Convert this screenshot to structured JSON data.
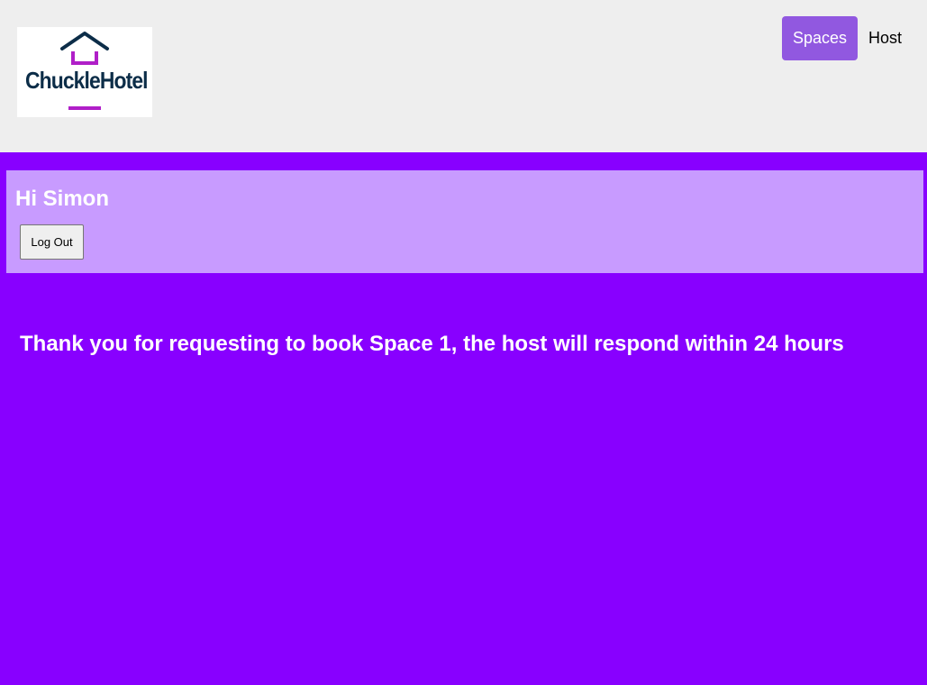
{
  "logo": {
    "brand_text": "ChuckleHotel",
    "alt": "ChuckleHotel logo",
    "colors": {
      "navy": "#0c2d48",
      "magenta": "#b01fc8"
    }
  },
  "nav": {
    "items": [
      {
        "label": "Spaces",
        "active": true
      },
      {
        "label": "Host",
        "active": false
      }
    ]
  },
  "user": {
    "greeting": "Hi Simon",
    "logout_label": "Log Out"
  },
  "confirmation": {
    "message": "Thank you for requesting to book Space 1, the host will respond within 24 hours"
  },
  "colors": {
    "page_background": "#8800ff",
    "header_background": "#eeeeee",
    "panel_background": "#c89bff",
    "active_nav": "#9158e0"
  }
}
